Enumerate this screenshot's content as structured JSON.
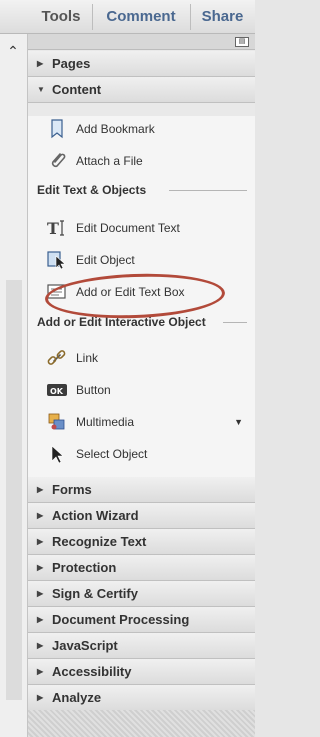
{
  "tabs": {
    "tools": "Tools",
    "comment": "Comment",
    "share": "Share"
  },
  "sections": {
    "pages": "Pages",
    "content": "Content",
    "forms": "Forms",
    "action_wizard": "Action Wizard",
    "recognize_text": "Recognize Text",
    "protection": "Protection",
    "sign_certify": "Sign & Certify",
    "document_processing": "Document Processing",
    "javascript": "JavaScript",
    "accessibility": "Accessibility",
    "analyze": "Analyze"
  },
  "content": {
    "add_bookmark": "Add Bookmark",
    "attach_file": "Attach a File",
    "edit_text_objects_header": "Edit Text & Objects",
    "edit_document_text": "Edit Document Text",
    "edit_object": "Edit Object",
    "add_edit_text_box": "Add or Edit Text Box",
    "interactive_header": "Add or Edit Interactive Object",
    "link": "Link",
    "button": "Button",
    "multimedia": "Multimedia",
    "select_object": "Select Object"
  },
  "colors": {
    "accent_tab": "#4a6890",
    "highlight": "#b24a3a"
  }
}
